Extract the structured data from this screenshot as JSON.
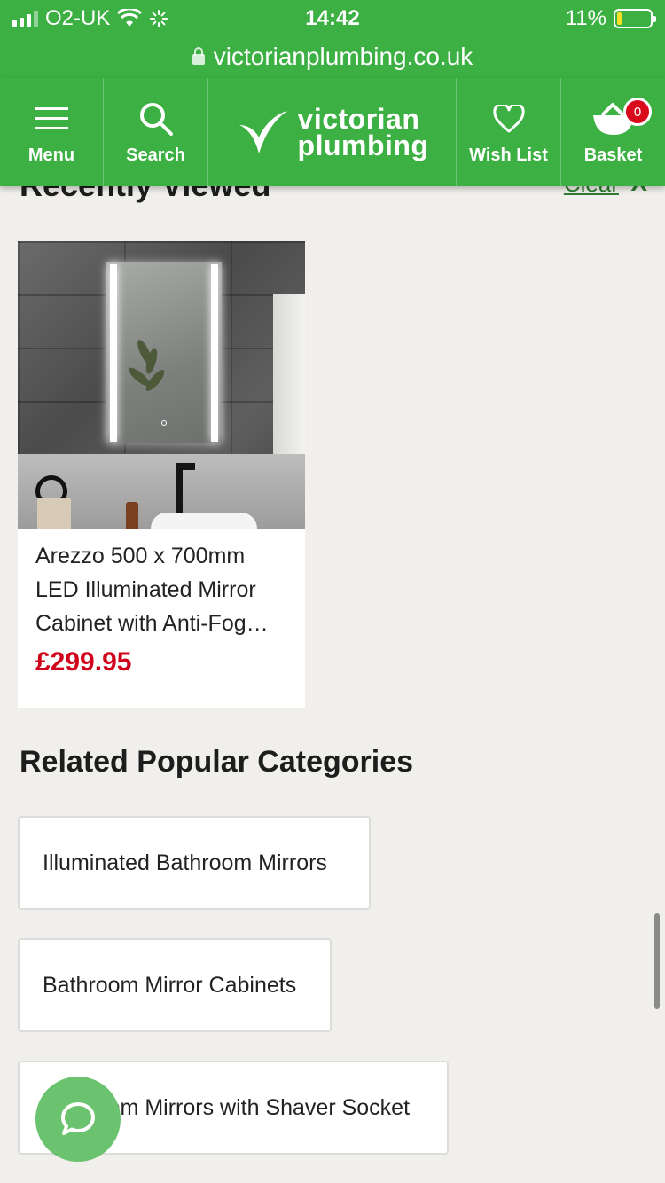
{
  "status_bar": {
    "carrier": "O2-UK",
    "time": "14:42",
    "battery": "11%",
    "battery_level": 0.11
  },
  "browser": {
    "url": "victorianplumbing.co.uk"
  },
  "header": {
    "menu_label": "Menu",
    "search_label": "Search",
    "logo_line1": "victorian",
    "logo_line2": "plumbing",
    "wishlist_label": "Wish List",
    "basket_label": "Basket",
    "basket_count": "0"
  },
  "recently_viewed": {
    "title": "Recently Viewed",
    "clear_label": "Clear",
    "close_label": "X",
    "products": [
      {
        "name": "Arezzo 500 x 700mm LED Illuminated Mirror Cabinet with Anti-Fog…",
        "price": "£299.95"
      }
    ]
  },
  "related": {
    "title": "Related Popular Categories",
    "categories": [
      "Illuminated Bathroom Mirrors",
      "Bathroom Mirror Cabinets",
      "Bathroom Mirrors with Shaver Socket"
    ]
  },
  "colors": {
    "brand_green": "#3cb043",
    "price_red": "#d0021b",
    "chat_green": "#6cc36f"
  },
  "icons": [
    "signal-icon",
    "wifi-icon",
    "loading-icon",
    "battery-icon",
    "lock-icon",
    "hamburger-icon",
    "search-icon",
    "logo-icon",
    "heart-icon",
    "basket-icon",
    "chat-icon"
  ]
}
